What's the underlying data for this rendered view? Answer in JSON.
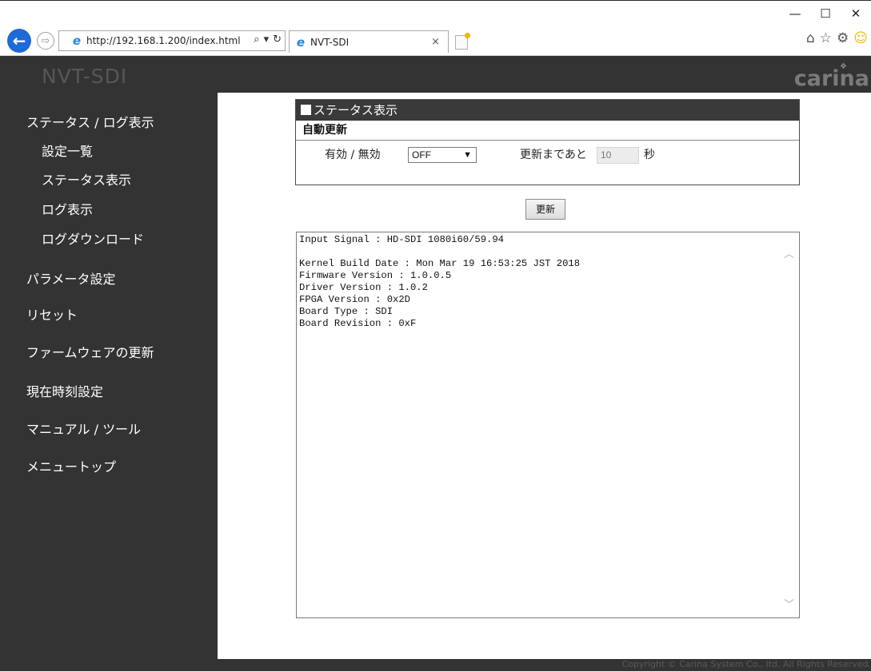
{
  "browser": {
    "url": "http://192.168.1.200/index.html",
    "search_icon": "search-icon",
    "refresh_icon": "refresh-icon",
    "tab_title": "NVT-SDI",
    "tab_close": "×",
    "minimize": "—",
    "maximize": "☐",
    "close": "✕",
    "ie_glyph": "e",
    "back_glyph": "←",
    "forward_glyph": "⇨",
    "home_glyph": "⌂",
    "star_glyph": "☆",
    "gear_glyph": "⚙",
    "smiley_glyph": "☺"
  },
  "header": {
    "brand": "NVT-SDI",
    "logo": "carina"
  },
  "sidebar": {
    "items": [
      {
        "label": "ステータス / ログ表示"
      },
      {
        "label": "設定一覧"
      },
      {
        "label": "ステータス表示"
      },
      {
        "label": "ログ表示"
      },
      {
        "label": "ログダウンロード"
      },
      {
        "label": "パラメータ設定"
      },
      {
        "label": "リセット"
      },
      {
        "label": "ファームウェアの更新"
      },
      {
        "label": "現在時刻設定"
      },
      {
        "label": "マニュアル / ツール"
      },
      {
        "label": "メニュートップ"
      }
    ]
  },
  "status_panel": {
    "title": "ステータス表示",
    "auto_update_label": "自動更新",
    "enable_label": "有効 / 無効",
    "select_value": "OFF",
    "until_label": "更新まであと",
    "seconds_value": "10",
    "seconds_unit": "秒"
  },
  "refresh_button": "更新",
  "log": {
    "text": "Input Signal : HD-SDI 1080i60/59.94\n\nKernel Build Date : Mon Mar 19 16:53:25 JST 2018\nFirmware Version : 1.0.0.5\nDriver Version : 1.0.2\nFPGA Version : 0x2D\nBoard Type : SDI\nBoard Revision : 0xF"
  },
  "footer": {
    "copyright": "Copyright © Carina System Co., ltd. All Rights Reserved."
  }
}
